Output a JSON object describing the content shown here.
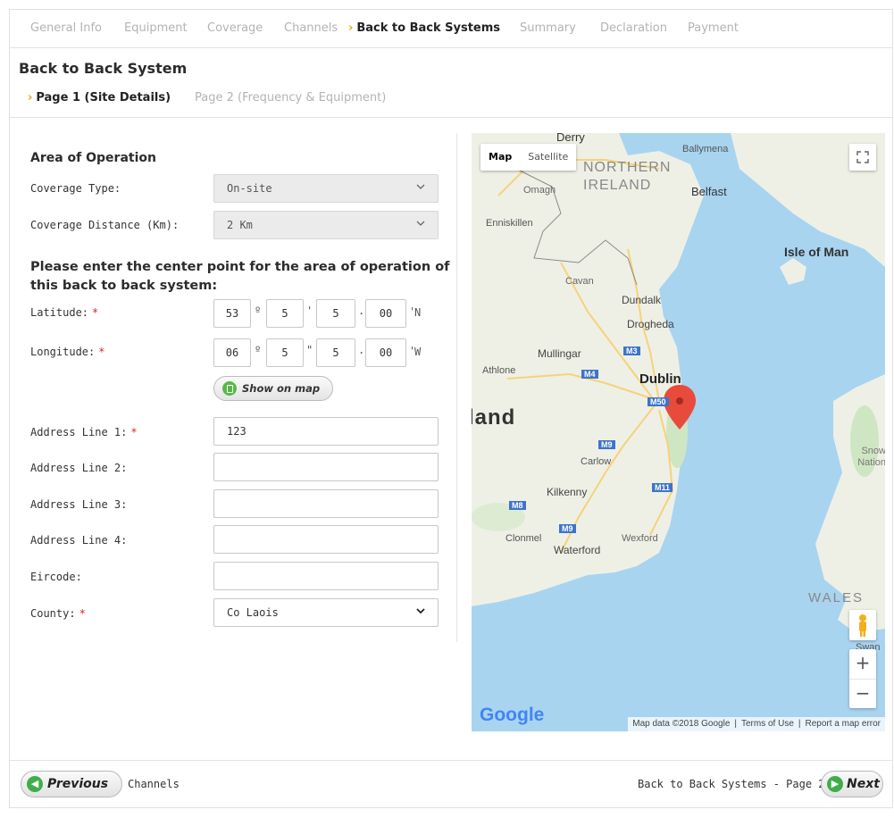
{
  "steps": [
    {
      "label": "General Info"
    },
    {
      "label": "Equipment"
    },
    {
      "label": "Coverage"
    },
    {
      "label": "Channels"
    },
    {
      "label": "Back to Back Systems"
    },
    {
      "label": "Summary"
    },
    {
      "label": "Declaration"
    },
    {
      "label": "Payment"
    }
  ],
  "page_title": "Back to Back System",
  "subtabs": [
    {
      "label": "Page 1 (Site Details)"
    },
    {
      "label": "Page 2 (Frequency & Equipment)"
    }
  ],
  "area": {
    "heading": "Area of Operation",
    "coverage_type": {
      "label": "Coverage Type:",
      "value": "On-site"
    },
    "coverage_distance": {
      "label": "Coverage Distance (Km):",
      "value": "2 Km"
    }
  },
  "center_heading": "Please enter the center point for the area of operation of this back to back system:",
  "latitude": {
    "label": "Latitude:",
    "deg": "53",
    "min": "5",
    "sec": "5",
    "dec": "00",
    "dir": "N"
  },
  "longitude": {
    "label": "Longitude:",
    "deg": "06",
    "min": "5",
    "sec": "5",
    "dec": "00",
    "dir": "W"
  },
  "symbols": {
    "degree": "º",
    "minute": "'",
    "second": "\"",
    "dot": "."
  },
  "required_mark": "*",
  "show_on_map": "Show on map",
  "address": {
    "line1": {
      "label": "Address Line 1:",
      "value": "123"
    },
    "line2": {
      "label": "Address Line 2:",
      "value": ""
    },
    "line3": {
      "label": "Address Line 3:",
      "value": ""
    },
    "line4": {
      "label": "Address Line 4:",
      "value": ""
    },
    "eircode": {
      "label": "Eircode:",
      "value": ""
    },
    "county": {
      "label": "County:",
      "value": "Co Laois"
    }
  },
  "map": {
    "type_map": "Map",
    "type_satellite": "Satellite",
    "labels": {
      "derry": "Derry",
      "ballymena": "Ballymena",
      "northern": "NORTHERN",
      "ireland_ni": "IRELAND",
      "omagh": "Omagh",
      "belfast": "Belfast",
      "enniskillen": "Enniskillen",
      "isle_of_man": "Isle of Man",
      "cavan": "Cavan",
      "dundalk": "Dundalk",
      "drogheda": "Drogheda",
      "mullingar": "Mullingar",
      "athlone": "Athlone",
      "dublin": "Dublin",
      "ireland_partial": "land",
      "carlow": "Carlow",
      "kilkenny": "Kilkenny",
      "clonmel": "Clonmel",
      "waterford": "Waterford",
      "wexford": "Wexford",
      "wales": "WALES",
      "snowdonia": "Snow Nation",
      "swansea": "Swan",
      "m3": "M3",
      "m4": "M4",
      "m50": "M50",
      "m9": "M9",
      "m11": "M11",
      "m8": "M8",
      "m9b": "M9"
    },
    "google": "Google",
    "attribution": {
      "data": "Map data ©2018 Google",
      "terms": "Terms of Use",
      "report": "Report a map error"
    },
    "zoom_in": "+",
    "zoom_out": "−"
  },
  "footer": {
    "previous": "Previous",
    "previous_target": "Channels",
    "next_target": "Back to Back Systems - Page 2",
    "next": "Next"
  }
}
